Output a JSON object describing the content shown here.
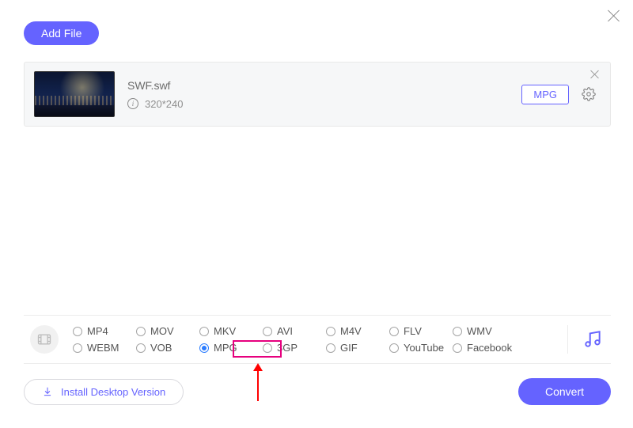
{
  "header": {
    "add_file_label": "Add File"
  },
  "file": {
    "name": "SWF.swf",
    "resolution": "320*240",
    "target_format": "MPG"
  },
  "formats": {
    "row1": [
      {
        "id": "mp4",
        "label": "MP4",
        "selected": false
      },
      {
        "id": "mov",
        "label": "MOV",
        "selected": false
      },
      {
        "id": "mkv",
        "label": "MKV",
        "selected": false
      },
      {
        "id": "avi",
        "label": "AVI",
        "selected": false
      },
      {
        "id": "m4v",
        "label": "M4V",
        "selected": false
      },
      {
        "id": "flv",
        "label": "FLV",
        "selected": false
      },
      {
        "id": "wmv",
        "label": "WMV",
        "selected": false
      }
    ],
    "row2": [
      {
        "id": "webm",
        "label": "WEBM",
        "selected": false
      },
      {
        "id": "vob",
        "label": "VOB",
        "selected": false
      },
      {
        "id": "mpg",
        "label": "MPG",
        "selected": true
      },
      {
        "id": "3gp",
        "label": "3GP",
        "selected": false
      },
      {
        "id": "gif",
        "label": "GIF",
        "selected": false
      },
      {
        "id": "youtube",
        "label": "YouTube",
        "selected": false
      },
      {
        "id": "facebook",
        "label": "Facebook",
        "selected": false
      }
    ]
  },
  "footer": {
    "install_label": "Install Desktop Version",
    "convert_label": "Convert"
  }
}
